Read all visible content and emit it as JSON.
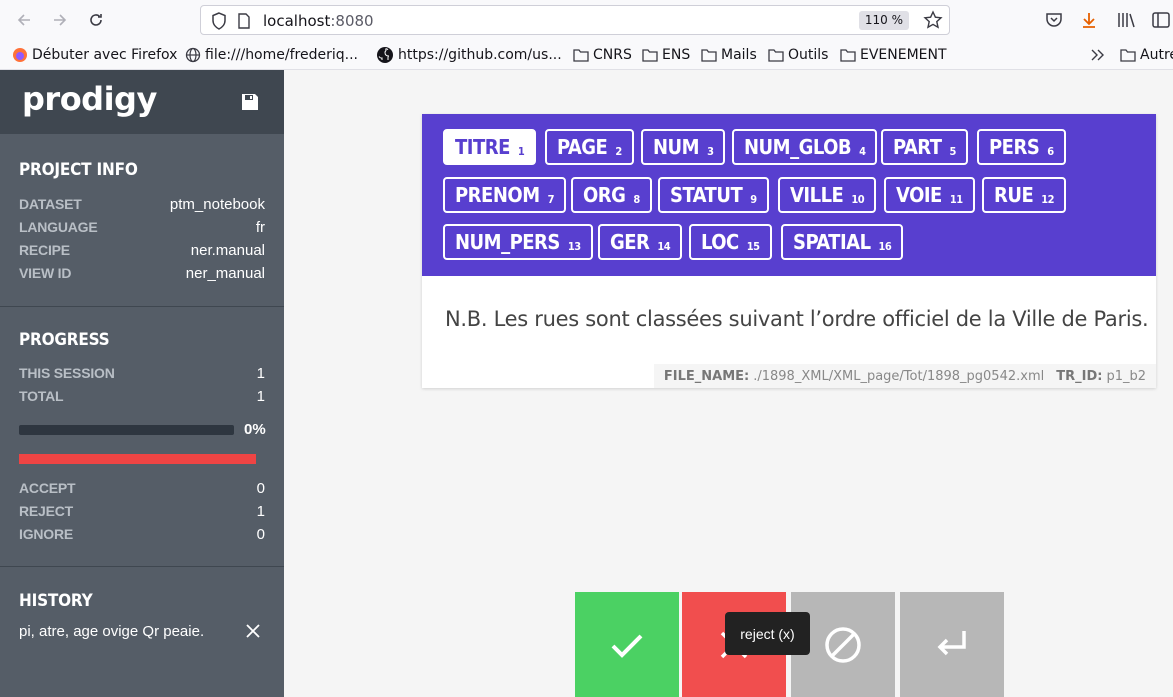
{
  "browser": {
    "url_host": "localhost",
    "url_port": ":8080",
    "zoom": "110 %",
    "bookmarks": [
      {
        "label": "Débuter avec Firefox"
      },
      {
        "label": "file:///home/frederiq..."
      },
      {
        "label": "https://github.com/us..."
      },
      {
        "label": "CNRS"
      },
      {
        "label": "ENS"
      },
      {
        "label": "Mails"
      },
      {
        "label": "Outils"
      },
      {
        "label": "EVENEMENT"
      },
      {
        "label": "Autre"
      }
    ]
  },
  "sidebar": {
    "logo": "prodigy",
    "project_info": {
      "title": "PROJECT INFO",
      "rows": [
        {
          "key": "DATASET",
          "value": "ptm_notebook"
        },
        {
          "key": "LANGUAGE",
          "value": "fr"
        },
        {
          "key": "RECIPE",
          "value": "ner.manual"
        },
        {
          "key": "VIEW ID",
          "value": "ner_manual"
        }
      ]
    },
    "progress": {
      "title": "PROGRESS",
      "this_session_label": "THIS SESSION",
      "this_session": "1",
      "total_label": "TOTAL",
      "total": "1",
      "percent": "0%",
      "accept_label": "ACCEPT",
      "accept": "0",
      "reject_label": "REJECT",
      "reject": "1",
      "ignore_label": "IGNORE",
      "ignore": "0"
    },
    "history": {
      "title": "HISTORY",
      "item": "pi, atre, age ovige Qr peaie."
    }
  },
  "labels": [
    {
      "name": "TITRE",
      "key": "1",
      "selected": true
    },
    {
      "name": "PAGE",
      "key": "2"
    },
    {
      "name": "NUM",
      "key": "3"
    },
    {
      "name": "NUM_GLOB",
      "key": "4"
    },
    {
      "name": "PART",
      "key": "5"
    },
    {
      "name": "PERS",
      "key": "6"
    },
    {
      "name": "PRENOM",
      "key": "7"
    },
    {
      "name": "ORG",
      "key": "8"
    },
    {
      "name": "STATUT",
      "key": "9"
    },
    {
      "name": "VILLE",
      "key": "10"
    },
    {
      "name": "VOIE",
      "key": "11"
    },
    {
      "name": "RUE",
      "key": "12"
    },
    {
      "name": "NUM_PERS",
      "key": "13"
    },
    {
      "name": "GER",
      "key": "14"
    },
    {
      "name": "LOC",
      "key": "15"
    },
    {
      "name": "SPATIAL",
      "key": "16"
    }
  ],
  "task": {
    "text": "N.B. Les rues sont classées suivant l’ordre officiel de la Ville de Paris.",
    "meta": {
      "file_name_label": "FILE_NAME:",
      "file_name": "./1898_XML/XML_page/Tot/1898_pg0542.xml",
      "tr_id_label": "TR_ID:",
      "tr_id": "p1_b2"
    }
  },
  "actions": {
    "tooltip": "reject (x)"
  },
  "colors": {
    "accept": "#4bd163",
    "reject": "#f14e4e",
    "ignore": "#b7b7b7",
    "undo": "#b7b7b7",
    "label_panel": "#583fcf"
  }
}
